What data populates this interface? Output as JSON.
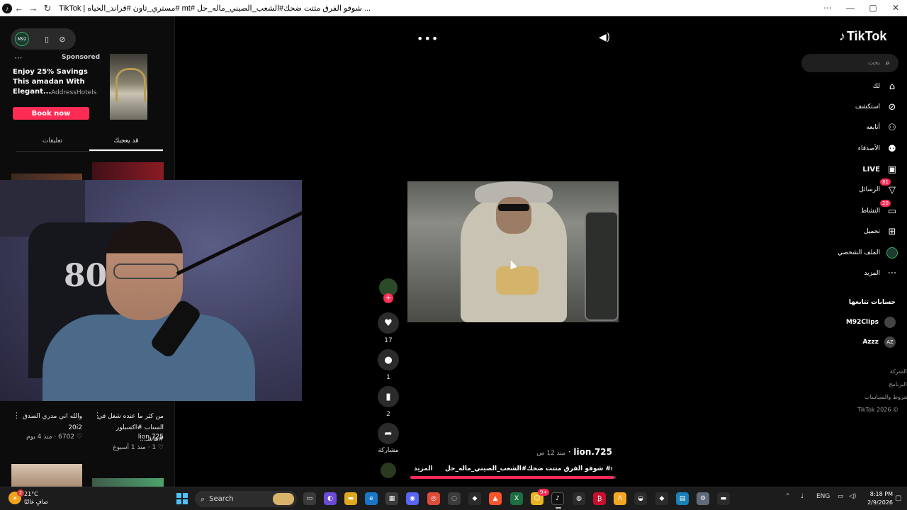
{
  "titlebar": {
    "title": "TikTok | مستري_تاون #قراند_الحياه# mt# شوفو الفرق متتت ضحك#الشعب_الصيني_ماله_حل ...",
    "back": "←",
    "forward": "→",
    "reload": "↻",
    "menu": "⋯",
    "minimize": "—",
    "maximize": "▢",
    "close": "✕"
  },
  "left": {
    "sponsored_label": "Sponsored",
    "ad_title": "Enjoy 25% Savings This amadan With Elegant...",
    "ad_brand": "AddressHotels",
    "ad_button": "Book now",
    "tabs": [
      "تعليقات",
      "قد يعجبك"
    ],
    "cards": [
      {
        "caption": "والله اني مدري الصدق 20i2",
        "likes": "6702",
        "ago": "منذ 4 يوم"
      },
      {
        "caption": "من كثر ما عنده شغل في السناب #اكسبلور #هاشـ...",
        "user": "lion.725",
        "likes": "1",
        "ago": "منذ 1 أسبوع"
      }
    ]
  },
  "video": {
    "likes": "17",
    "comments": "1",
    "saves": "2",
    "share_label": "مشاركة",
    "author": "lion.725",
    "ago": "منذ 12 س",
    "description": "شوفو الفرق متتت ضحك#الشعب_الصيني_ماله_حل #mt ...",
    "more": "المزيد",
    "progress": 0.99
  },
  "nav": {
    "logo": "TikTok",
    "search_placeholder": "بحث",
    "items": [
      {
        "label": "لك",
        "icon": "home-icon"
      },
      {
        "label": "استكشف",
        "icon": "compass-icon"
      },
      {
        "label": "أتابعه",
        "icon": "user-follow-icon"
      },
      {
        "label": "الأصدقاء",
        "icon": "friends-icon"
      },
      {
        "label": "LIVE",
        "icon": "live-icon"
      },
      {
        "label": "الرسائل",
        "icon": "messages-icon",
        "badge": "81"
      },
      {
        "label": "النشاط",
        "icon": "activity-icon",
        "badge": "20"
      },
      {
        "label": "تحميل",
        "icon": "upload-icon"
      },
      {
        "label": "الملف الشخصي",
        "icon": "profile-icon"
      },
      {
        "label": "المزيد",
        "icon": "more-icon"
      }
    ],
    "following_heading": "حسابات تتابعها",
    "following": [
      {
        "name": "M92Clips"
      },
      {
        "name": "Azzz",
        "initials": "AZ"
      }
    ],
    "footer": [
      "الشركة",
      "البرنامج",
      "الشروط والسياسات",
      "TikTok 2026 ©"
    ]
  },
  "taskbar": {
    "temp": "21°C",
    "weather_desc": "صافٍ غالبًا",
    "weather_badge": "2",
    "search": "Search",
    "lang": "ENG",
    "time": "8:18 PM",
    "date": "2/9/2026",
    "app_badge": "9+"
  },
  "colors": {
    "accent": "#fe2c55",
    "background": "#000000"
  }
}
